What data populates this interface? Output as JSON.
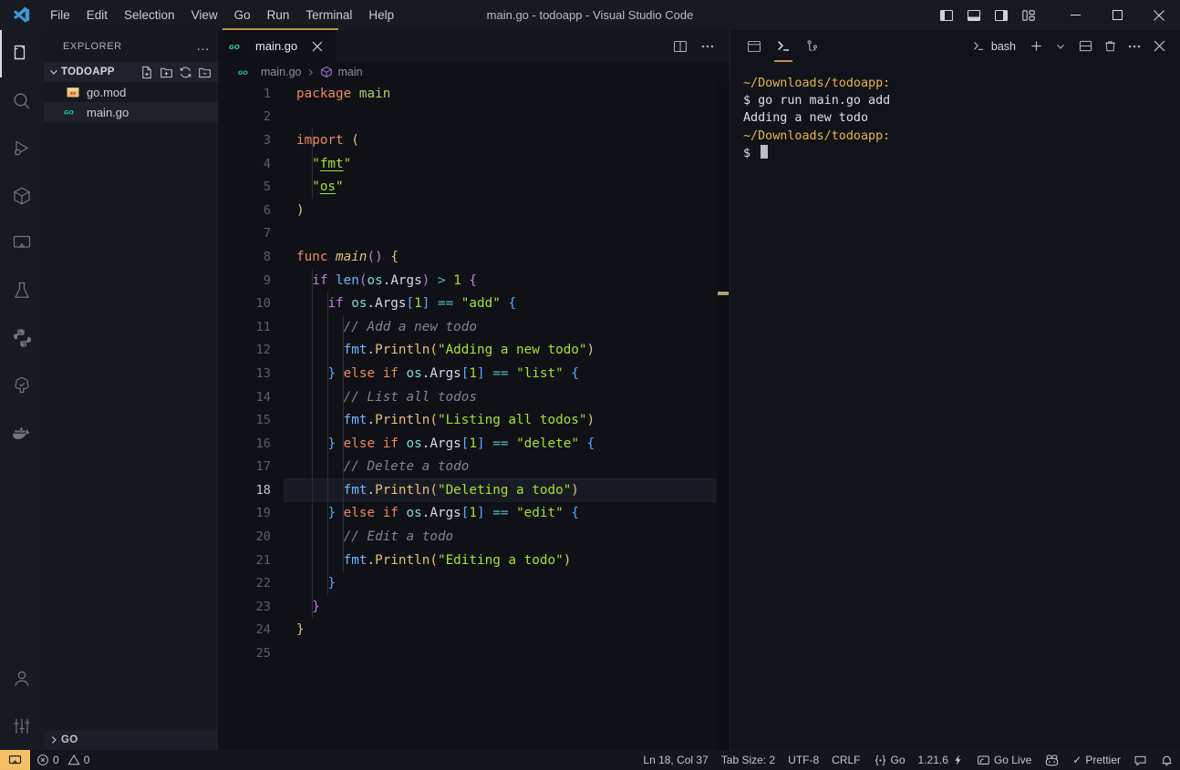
{
  "titlebar": {
    "title": "main.go - todoapp - Visual Studio Code",
    "menus": [
      "File",
      "Edit",
      "Selection",
      "View",
      "Go",
      "Run",
      "Terminal",
      "Help"
    ],
    "layout_buttons": [
      {
        "name": "toggle-primary-sidebar",
        "label": "Toggle Primary Side Bar"
      },
      {
        "name": "toggle-panel",
        "label": "Toggle Panel"
      },
      {
        "name": "toggle-secondary-sidebar",
        "label": "Toggle Secondary Side Bar"
      },
      {
        "name": "customize-layout",
        "label": "Customize Layout"
      }
    ],
    "window_buttons": [
      "minimize",
      "maximize",
      "close"
    ]
  },
  "activitybar": {
    "items": [
      {
        "name": "explorer",
        "label": "Explorer",
        "active": true
      },
      {
        "name": "search",
        "label": "Search",
        "active": false
      },
      {
        "name": "run-and-debug",
        "label": "Run and Debug",
        "active": false
      },
      {
        "name": "extensions",
        "label": "Extensions",
        "active": false
      },
      {
        "name": "remote-explorer",
        "label": "Remote Explorer",
        "active": false
      },
      {
        "name": "testing",
        "label": "Testing",
        "active": false
      },
      {
        "name": "python",
        "label": "Python",
        "active": false
      },
      {
        "name": "tree-check",
        "label": "Source Control Check",
        "active": false
      },
      {
        "name": "docker",
        "label": "Docker",
        "active": false
      }
    ],
    "bottom": [
      {
        "name": "accounts",
        "label": "Accounts"
      },
      {
        "name": "manage-settings",
        "label": "Manage"
      }
    ]
  },
  "sidebar": {
    "title": "EXPLORER",
    "more_label": "…",
    "folder": {
      "name": "TODOAPP",
      "expanded": true,
      "actions": [
        "new-file",
        "new-folder",
        "refresh",
        "collapse-all"
      ]
    },
    "files": [
      {
        "name": "go.mod",
        "icon": "go-mod-icon",
        "selected": false
      },
      {
        "name": "main.go",
        "icon": "go-icon",
        "selected": true
      }
    ],
    "bottom_section": {
      "label": "GO",
      "expanded": false
    }
  },
  "editor": {
    "tab": {
      "label": "main.go",
      "icon": "go-icon",
      "close_label": "×"
    },
    "tab_actions": [
      "split-editor",
      "more-actions"
    ],
    "breadcrumb": [
      {
        "label": "main.go",
        "icon": "go-icon"
      },
      {
        "label": "main",
        "icon": "symbol-method-icon"
      }
    ],
    "language": "go",
    "lines": [
      {
        "n": 1,
        "indent": 0,
        "tokens": [
          {
            "t": "package",
            "c": "kw"
          },
          {
            "t": " ",
            "c": "ident"
          },
          {
            "t": "main",
            "c": "type"
          }
        ]
      },
      {
        "n": 2,
        "indent": 0,
        "tokens": []
      },
      {
        "n": 3,
        "indent": 0,
        "tokens": [
          {
            "t": "import",
            "c": "kw"
          },
          {
            "t": " ",
            "c": "ident"
          },
          {
            "t": "(",
            "c": "p-yel"
          }
        ]
      },
      {
        "n": 4,
        "indent": 1,
        "tokens": [
          {
            "t": "\"",
            "c": "str"
          },
          {
            "t": "fmt",
            "c": "str lnk"
          },
          {
            "t": "\"",
            "c": "str"
          }
        ]
      },
      {
        "n": 5,
        "indent": 1,
        "tokens": [
          {
            "t": "\"",
            "c": "str"
          },
          {
            "t": "os",
            "c": "str lnk"
          },
          {
            "t": "\"",
            "c": "str"
          }
        ]
      },
      {
        "n": 6,
        "indent": 0,
        "tokens": [
          {
            "t": ")",
            "c": "p-yel"
          }
        ]
      },
      {
        "n": 7,
        "indent": 0,
        "tokens": []
      },
      {
        "n": 8,
        "indent": 0,
        "tokens": [
          {
            "t": "func",
            "c": "kw"
          },
          {
            "t": " ",
            "c": "ident"
          },
          {
            "t": "main",
            "c": "fn"
          },
          {
            "t": "(",
            "c": "p-pur"
          },
          {
            "t": ")",
            "c": "p-pur"
          },
          {
            "t": " ",
            "c": "ident"
          },
          {
            "t": "{",
            "c": "p-yel"
          }
        ]
      },
      {
        "n": 9,
        "indent": 1,
        "tokens": [
          {
            "t": "if",
            "c": "kw2"
          },
          {
            "t": " ",
            "c": "ident"
          },
          {
            "t": "len",
            "c": "pkg"
          },
          {
            "t": "(",
            "c": "p-pur"
          },
          {
            "t": "os",
            "c": "osid"
          },
          {
            "t": ".",
            "c": "ident"
          },
          {
            "t": "Args",
            "c": "ident"
          },
          {
            "t": ")",
            "c": "p-pur"
          },
          {
            "t": " ",
            "c": "ident"
          },
          {
            "t": ">",
            "c": "op"
          },
          {
            "t": " ",
            "c": "ident"
          },
          {
            "t": "1",
            "c": "num"
          },
          {
            "t": " ",
            "c": "ident"
          },
          {
            "t": "{",
            "c": "p-pur"
          }
        ]
      },
      {
        "n": 10,
        "indent": 2,
        "tokens": [
          {
            "t": "if",
            "c": "kw2"
          },
          {
            "t": " ",
            "c": "ident"
          },
          {
            "t": "os",
            "c": "osid"
          },
          {
            "t": ".",
            "c": "ident"
          },
          {
            "t": "Args",
            "c": "ident"
          },
          {
            "t": "[",
            "c": "p-blu"
          },
          {
            "t": "1",
            "c": "num"
          },
          {
            "t": "]",
            "c": "p-blu"
          },
          {
            "t": " ",
            "c": "ident"
          },
          {
            "t": "==",
            "c": "op"
          },
          {
            "t": " ",
            "c": "ident"
          },
          {
            "t": "\"add\"",
            "c": "str"
          },
          {
            "t": " ",
            "c": "ident"
          },
          {
            "t": "{",
            "c": "p-blu"
          }
        ]
      },
      {
        "n": 11,
        "indent": 3,
        "tokens": [
          {
            "t": "// Add a new todo",
            "c": "cmt"
          }
        ]
      },
      {
        "n": 12,
        "indent": 3,
        "tokens": [
          {
            "t": "fmt",
            "c": "pkg"
          },
          {
            "t": ".",
            "c": "ident"
          },
          {
            "t": "Println",
            "c": "prop"
          },
          {
            "t": "(",
            "c": "p-yel"
          },
          {
            "t": "\"Adding a new todo\"",
            "c": "str"
          },
          {
            "t": ")",
            "c": "p-yel"
          }
        ]
      },
      {
        "n": 13,
        "indent": 2,
        "tokens": [
          {
            "t": "}",
            "c": "p-blu"
          },
          {
            "t": " ",
            "c": "ident"
          },
          {
            "t": "else",
            "c": "kw"
          },
          {
            "t": " ",
            "c": "ident"
          },
          {
            "t": "if",
            "c": "kw"
          },
          {
            "t": " ",
            "c": "ident"
          },
          {
            "t": "os",
            "c": "osid"
          },
          {
            "t": ".",
            "c": "ident"
          },
          {
            "t": "Args",
            "c": "ident"
          },
          {
            "t": "[",
            "c": "p-blu"
          },
          {
            "t": "1",
            "c": "num"
          },
          {
            "t": "]",
            "c": "p-blu"
          },
          {
            "t": " ",
            "c": "ident"
          },
          {
            "t": "==",
            "c": "op"
          },
          {
            "t": " ",
            "c": "ident"
          },
          {
            "t": "\"list\"",
            "c": "str"
          },
          {
            "t": " ",
            "c": "ident"
          },
          {
            "t": "{",
            "c": "p-blu"
          }
        ]
      },
      {
        "n": 14,
        "indent": 3,
        "tokens": [
          {
            "t": "// List all todos",
            "c": "cmt"
          }
        ]
      },
      {
        "n": 15,
        "indent": 3,
        "tokens": [
          {
            "t": "fmt",
            "c": "pkg"
          },
          {
            "t": ".",
            "c": "ident"
          },
          {
            "t": "Println",
            "c": "prop"
          },
          {
            "t": "(",
            "c": "p-yel"
          },
          {
            "t": "\"Listing all todos\"",
            "c": "str"
          },
          {
            "t": ")",
            "c": "p-yel"
          }
        ]
      },
      {
        "n": 16,
        "indent": 2,
        "tokens": [
          {
            "t": "}",
            "c": "p-blu"
          },
          {
            "t": " ",
            "c": "ident"
          },
          {
            "t": "else",
            "c": "kw"
          },
          {
            "t": " ",
            "c": "ident"
          },
          {
            "t": "if",
            "c": "kw"
          },
          {
            "t": " ",
            "c": "ident"
          },
          {
            "t": "os",
            "c": "osid"
          },
          {
            "t": ".",
            "c": "ident"
          },
          {
            "t": "Args",
            "c": "ident"
          },
          {
            "t": "[",
            "c": "p-blu"
          },
          {
            "t": "1",
            "c": "num"
          },
          {
            "t": "]",
            "c": "p-blu"
          },
          {
            "t": " ",
            "c": "ident"
          },
          {
            "t": "==",
            "c": "op"
          },
          {
            "t": " ",
            "c": "ident"
          },
          {
            "t": "\"delete\"",
            "c": "str"
          },
          {
            "t": " ",
            "c": "ident"
          },
          {
            "t": "{",
            "c": "p-blu"
          }
        ]
      },
      {
        "n": 17,
        "indent": 3,
        "tokens": [
          {
            "t": "// Delete a todo",
            "c": "cmt"
          }
        ]
      },
      {
        "n": 18,
        "indent": 3,
        "current": true,
        "tokens": [
          {
            "t": "fmt",
            "c": "pkg"
          },
          {
            "t": ".",
            "c": "ident"
          },
          {
            "t": "Println",
            "c": "prop"
          },
          {
            "t": "(",
            "c": "p-yel"
          },
          {
            "t": "\"Deleting a todo\"",
            "c": "str"
          },
          {
            "t": ")",
            "c": "p-yel"
          }
        ]
      },
      {
        "n": 19,
        "indent": 2,
        "tokens": [
          {
            "t": "}",
            "c": "p-blu"
          },
          {
            "t": " ",
            "c": "ident"
          },
          {
            "t": "else",
            "c": "kw"
          },
          {
            "t": " ",
            "c": "ident"
          },
          {
            "t": "if",
            "c": "kw"
          },
          {
            "t": " ",
            "c": "ident"
          },
          {
            "t": "os",
            "c": "osid"
          },
          {
            "t": ".",
            "c": "ident"
          },
          {
            "t": "Args",
            "c": "ident"
          },
          {
            "t": "[",
            "c": "p-blu"
          },
          {
            "t": "1",
            "c": "num"
          },
          {
            "t": "]",
            "c": "p-blu"
          },
          {
            "t": " ",
            "c": "ident"
          },
          {
            "t": "==",
            "c": "op"
          },
          {
            "t": " ",
            "c": "ident"
          },
          {
            "t": "\"edit\"",
            "c": "str"
          },
          {
            "t": " ",
            "c": "ident"
          },
          {
            "t": "{",
            "c": "p-blu"
          }
        ]
      },
      {
        "n": 20,
        "indent": 3,
        "tokens": [
          {
            "t": "// Edit a todo",
            "c": "cmt"
          }
        ]
      },
      {
        "n": 21,
        "indent": 3,
        "tokens": [
          {
            "t": "fmt",
            "c": "pkg"
          },
          {
            "t": ".",
            "c": "ident"
          },
          {
            "t": "Println",
            "c": "prop"
          },
          {
            "t": "(",
            "c": "p-yel"
          },
          {
            "t": "\"Editing a todo\"",
            "c": "str"
          },
          {
            "t": ")",
            "c": "p-yel"
          }
        ]
      },
      {
        "n": 22,
        "indent": 2,
        "tokens": [
          {
            "t": "}",
            "c": "p-blu"
          }
        ]
      },
      {
        "n": 23,
        "indent": 1,
        "tokens": [
          {
            "t": "}",
            "c": "p-pur"
          }
        ]
      },
      {
        "n": 24,
        "indent": 0,
        "tokens": [
          {
            "t": "}",
            "c": "p-yel"
          }
        ]
      },
      {
        "n": 25,
        "indent": 0,
        "tokens": []
      }
    ]
  },
  "panel": {
    "tabs": [
      {
        "name": "maximize-panel",
        "label": "Views and More Actions",
        "active": false
      },
      {
        "name": "terminal",
        "label": "Terminal",
        "active": true
      },
      {
        "name": "source-control-graph",
        "label": "Source Control Graph",
        "active": false
      }
    ],
    "shell": "bash",
    "actions": [
      "new-terminal",
      "terminal-dropdown",
      "split-terminal",
      "kill-terminal",
      "more-actions",
      "close-panel"
    ],
    "terminal_lines": [
      {
        "text": "~/Downloads/todoapp:",
        "class": "t-path"
      },
      {
        "text": "$ go run main.go add",
        "class": ""
      },
      {
        "text": "Adding a new todo",
        "class": ""
      },
      {
        "text": "~/Downloads/todoapp:",
        "class": "t-path"
      },
      {
        "text": "$ ",
        "class": "",
        "cursor": true
      }
    ]
  },
  "statusbar": {
    "remote_label": "",
    "errors": "0",
    "warnings": "0",
    "position": "Ln 18, Col 37",
    "tab_size": "Tab Size: 2",
    "encoding": "UTF-8",
    "eol": "CRLF",
    "language": "Go",
    "go_version": "1.21.6",
    "go_live": "Go Live",
    "formatter": "Prettier",
    "formatter_check": "✓"
  },
  "colors": {
    "accent_yellow": "#f3c164",
    "menu_underline": "#b89248",
    "go_blue": "#29beb0",
    "terminal_path": "#e8b548"
  }
}
